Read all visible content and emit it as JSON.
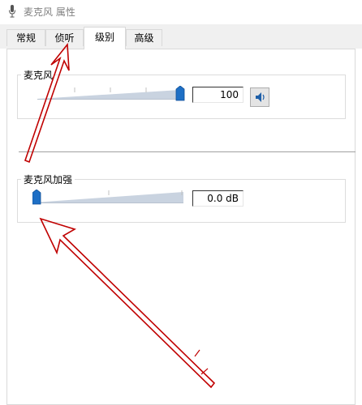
{
  "window": {
    "title": "麦克风 属性",
    "icon": "microphone-icon"
  },
  "tabs": [
    {
      "label": "常规",
      "active": false
    },
    {
      "label": "侦听",
      "active": false
    },
    {
      "label": "级别",
      "active": true
    },
    {
      "label": "高级",
      "active": false
    }
  ],
  "levels": {
    "microphone": {
      "label": "麦克风",
      "value": "100",
      "level_fraction": 1.0,
      "speaker_icon": "speaker-icon"
    },
    "boost": {
      "label": "麦克风加强",
      "value": "0.0 dB",
      "level_fraction": 0.0
    }
  },
  "annotations": {
    "arrow_color": "#c00000",
    "arrows": 2
  },
  "colors": {
    "slider_fill": "#c9d3e0",
    "thumb": "#1e6fc5",
    "annotation_arrow": "#c00000"
  }
}
